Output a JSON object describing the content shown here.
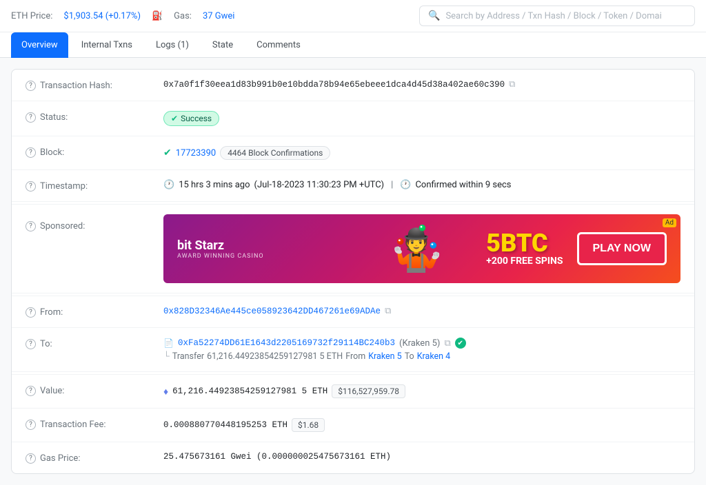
{
  "topbar": {
    "eth_prefix": "ETH Price:",
    "eth_price": "$1,903.54 (+0.17%)",
    "gas_prefix": "Gas:",
    "gas_value": "37 Gwei",
    "search_placeholder": "Search by Address / Txn Hash / Block / Token / Domai"
  },
  "tabs": [
    {
      "id": "overview",
      "label": "Overview",
      "active": true
    },
    {
      "id": "internal-txns",
      "label": "Internal Txns",
      "active": false
    },
    {
      "id": "logs",
      "label": "Logs (1)",
      "active": false
    },
    {
      "id": "state",
      "label": "State",
      "active": false
    },
    {
      "id": "comments",
      "label": "Comments",
      "active": false
    }
  ],
  "details": {
    "txn_hash_label": "Transaction Hash:",
    "txn_hash": "0x7a0f1f30eea1d83b991b0e10bdda78b94e65ebeee1dca4d45d38a402ae60c390",
    "status_label": "Status:",
    "status_text": "Success",
    "block_label": "Block:",
    "block_number": "17723390",
    "block_confirmations": "4464 Block Confirmations",
    "timestamp_label": "Timestamp:",
    "timestamp_ago": "15 hrs 3 mins ago",
    "timestamp_date": "(Jul-18-2023 11:30:23 PM +UTC)",
    "timestamp_separator": "|",
    "timestamp_confirmed": "Confirmed within 9 secs",
    "sponsored_label": "Sponsored:",
    "sponsor_brand": "bit Starz",
    "sponsor_sub": "AWARD WINNING CASINO",
    "sponsor_btc": "5BTC",
    "sponsor_spins": "+200 FREE SPINS",
    "sponsor_cta": "PLAY NOW",
    "from_label": "From:",
    "from_address": "0x828D32346Ae445ce058923642DD467261e69ADAe",
    "to_label": "To:",
    "to_address": "0xFa52274DD61E1643d2205169732f29114BC240b3",
    "to_label_name": "(Kraken 5)",
    "to_transfer_prefix": "Transfer",
    "to_transfer_amount": "61,216.44923854259127981 5 ETH",
    "to_transfer_from_label": "From",
    "to_transfer_from": "Kraken 5",
    "to_transfer_to_label": "To",
    "to_transfer_to": "Kraken 4",
    "value_label": "Value:",
    "value_eth": "61,216.44923854259127981 5 ETH",
    "value_usd": "$116,527,959.78",
    "fee_label": "Transaction Fee:",
    "fee_eth": "0.000880770448195253 ETH",
    "fee_usd": "$1.68",
    "gas_price_label": "Gas Price:",
    "gas_price": "25.475673161 Gwei (0.000000025475673161 ETH)"
  }
}
